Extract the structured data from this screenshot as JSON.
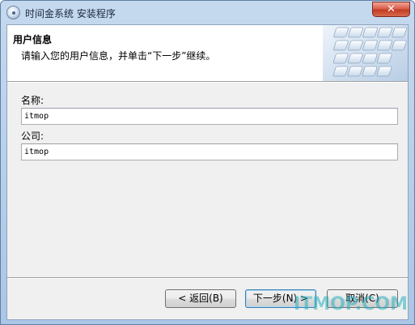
{
  "window": {
    "title": "时间金系统 安装程序",
    "close_label": "✕"
  },
  "header": {
    "title": "用户信息",
    "description": "请输入您的用户信息，并单击“下一步”继续。"
  },
  "form": {
    "name_label": "名称:",
    "name_value": "itmop",
    "company_label": "公司:",
    "company_value": "itmop"
  },
  "buttons": {
    "back_label": "< 返回(B)",
    "next_label": "下一步(N) >",
    "cancel_label": "取消(C)"
  },
  "watermark": "ITMOP.COM",
  "colors": {
    "title_bar": "#b9d1ea",
    "close_button": "#c94c36",
    "default_button_border": "#3c7fb1",
    "watermark": "#28afbe"
  },
  "icons": [
    "installer-disc-icon",
    "keyboard-banner-image"
  ]
}
